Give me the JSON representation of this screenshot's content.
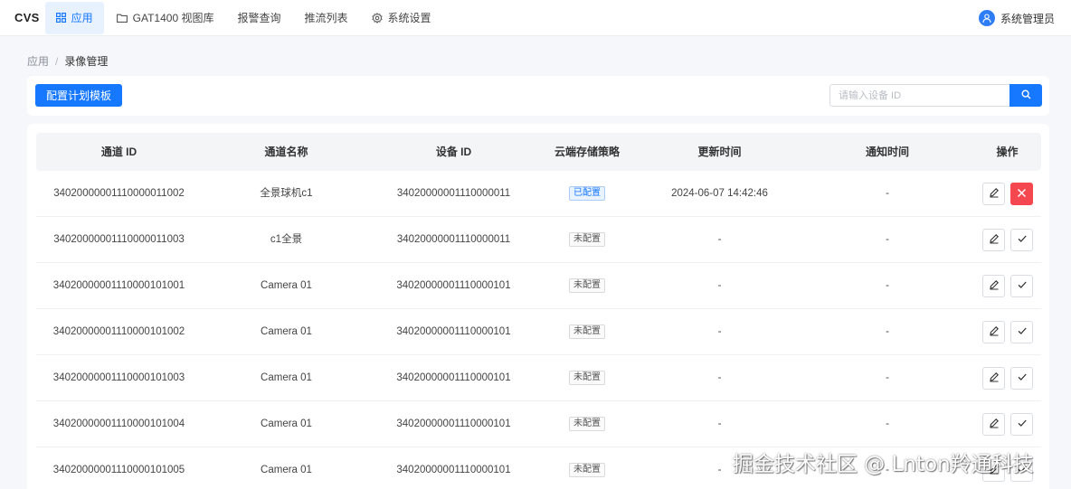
{
  "nav": {
    "brand": "CVS",
    "items": [
      {
        "label": "应用",
        "icon": "grid-icon",
        "active": true
      },
      {
        "label": "GAT1400 视图库",
        "icon": "folder-icon",
        "active": false
      },
      {
        "label": "报警查询",
        "icon": "",
        "active": false
      },
      {
        "label": "推流列表",
        "icon": "",
        "active": false
      },
      {
        "label": "系统设置",
        "icon": "gear-icon",
        "active": false
      }
    ],
    "user": "系统管理员"
  },
  "breadcrumb": {
    "root": "应用",
    "separator": "/",
    "current": "录像管理"
  },
  "toolbar": {
    "config_button": "配置计划模板",
    "search_placeholder": "请输入设备 ID",
    "search_value": ""
  },
  "table": {
    "columns": [
      "通道 ID",
      "通道名称",
      "设备 ID",
      "云端存储策略",
      "更新时间",
      "通知时间",
      "操作"
    ],
    "rows": [
      {
        "channel_id": "34020000001110000011002",
        "name": "全景球机c1",
        "device_id": "34020000001110000011",
        "policy": "已配置",
        "configured": true,
        "updated": "2024-06-07 14:42:46",
        "notified": "-"
      },
      {
        "channel_id": "34020000001110000011003",
        "name": "c1全景",
        "device_id": "34020000001110000011",
        "policy": "未配置",
        "configured": false,
        "updated": "-",
        "notified": "-"
      },
      {
        "channel_id": "34020000001110000101001",
        "name": "Camera 01",
        "device_id": "34020000001110000101",
        "policy": "未配置",
        "configured": false,
        "updated": "-",
        "notified": "-"
      },
      {
        "channel_id": "34020000001110000101002",
        "name": "Camera 01",
        "device_id": "34020000001110000101",
        "policy": "未配置",
        "configured": false,
        "updated": "-",
        "notified": "-"
      },
      {
        "channel_id": "34020000001110000101003",
        "name": "Camera 01",
        "device_id": "34020000001110000101",
        "policy": "未配置",
        "configured": false,
        "updated": "-",
        "notified": "-"
      },
      {
        "channel_id": "34020000001110000101004",
        "name": "Camera 01",
        "device_id": "34020000001110000101",
        "policy": "未配置",
        "configured": false,
        "updated": "-",
        "notified": "-"
      },
      {
        "channel_id": "34020000001110000101005",
        "name": "Camera 01",
        "device_id": "34020000001110000101",
        "policy": "未配置",
        "configured": false,
        "updated": "-",
        "notified": "-"
      }
    ]
  },
  "watermark": "掘金技术社区 @ Lnton羚通科技",
  "colors": {
    "primary": "#1677ff",
    "danger": "#f5474f"
  }
}
